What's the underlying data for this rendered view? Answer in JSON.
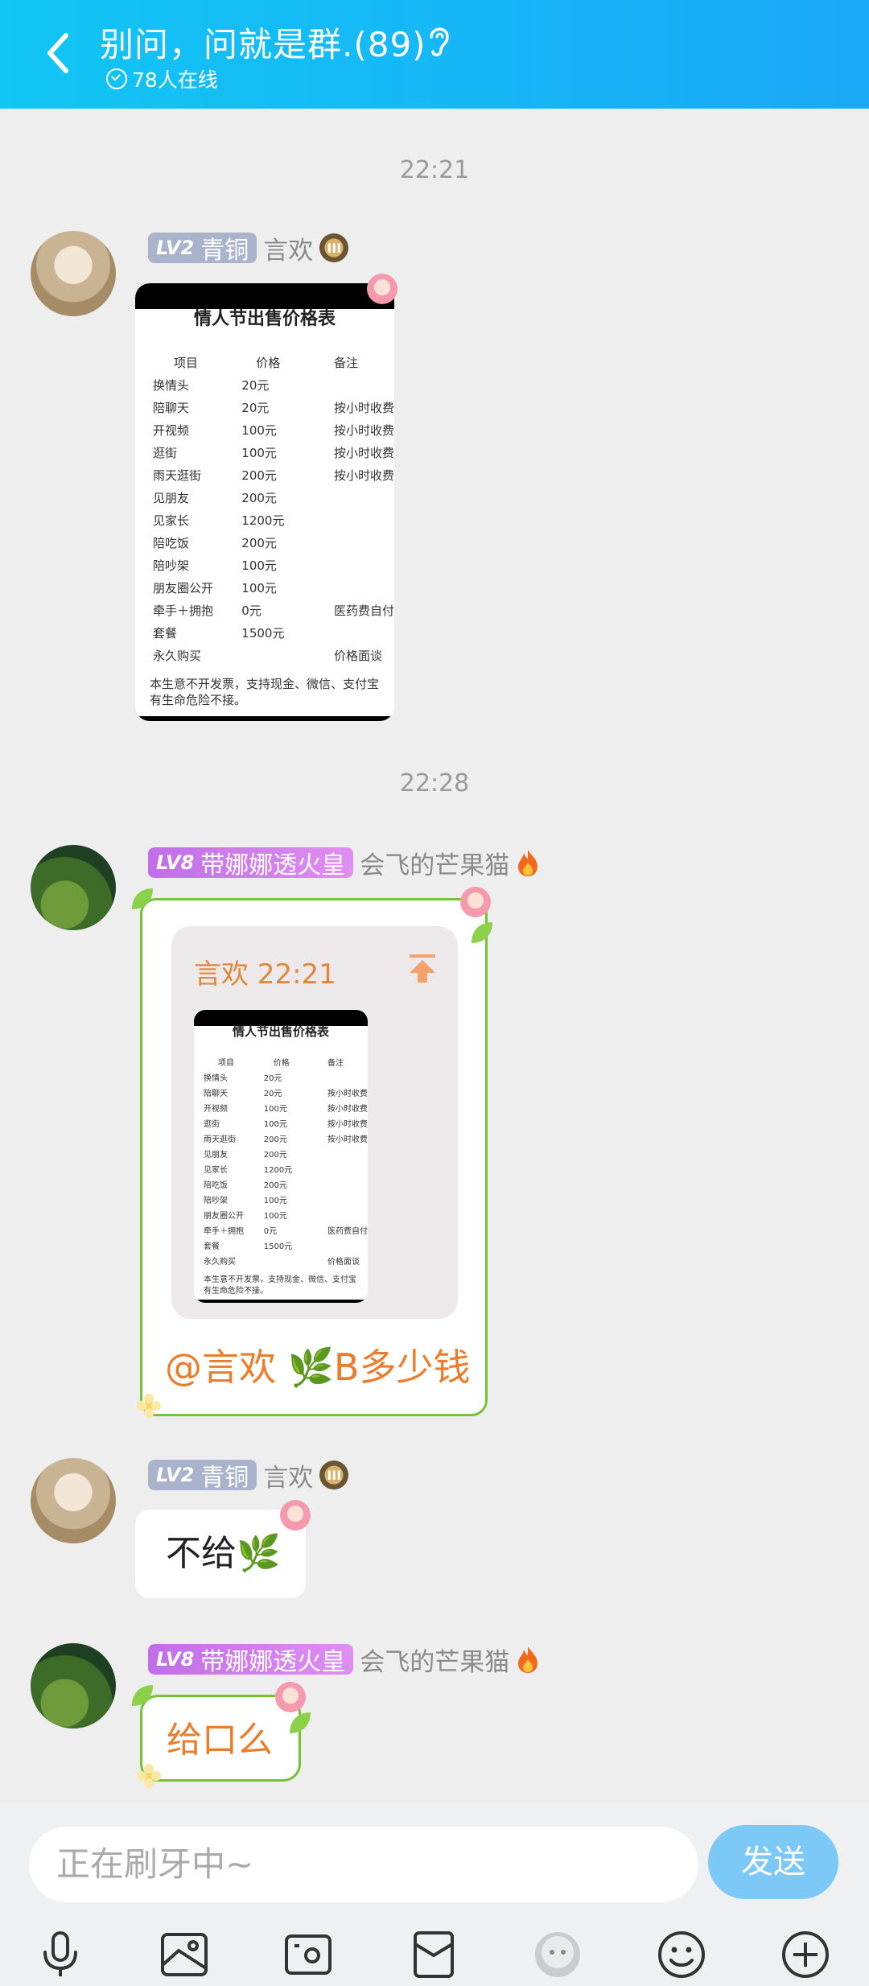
{
  "header": {
    "title": "别问，问就是群.(89)",
    "online": "78人在线"
  },
  "messages": [
    {
      "type": "time",
      "text": "22:21"
    },
    {
      "type": "image",
      "level": "LV2",
      "level_name": "青铜",
      "name": "言欢",
      "badge": "III"
    },
    {
      "type": "time",
      "text": "22:28"
    },
    {
      "type": "quote",
      "level": "LV8",
      "level_name": "带娜娜透火皇",
      "name": "会飞的芒果猫",
      "quoted_name": "言欢",
      "quoted_time": "22:21",
      "text": "@言欢 🌿B多少钱"
    },
    {
      "type": "text",
      "level": "LV2",
      "level_name": "青铜",
      "name": "言欢",
      "badge": "III",
      "text": "不给🌿"
    },
    {
      "type": "text",
      "level": "LV8",
      "level_name": "带娜娜透火皇",
      "name": "会飞的芒果猫",
      "text": "给口么"
    }
  ],
  "price_sheet": {
    "title": "情人节出售价格表",
    "headers": [
      "项目",
      "价格",
      "备注"
    ],
    "rows": [
      [
        "换情头",
        "20元",
        ""
      ],
      [
        "陪聊天",
        "20元",
        "按小时收费"
      ],
      [
        "开视频",
        "100元",
        "按小时收费"
      ],
      [
        "逛街",
        "100元",
        "按小时收费"
      ],
      [
        "雨天逛街",
        "200元",
        "按小时收费"
      ],
      [
        "见朋友",
        "200元",
        ""
      ],
      [
        "见家长",
        "1200元",
        ""
      ],
      [
        "陪吃饭",
        "200元",
        ""
      ],
      [
        "陪吵架",
        "100元",
        ""
      ],
      [
        "朋友圈公开",
        "100元",
        ""
      ],
      [
        "牵手＋拥抱",
        "0元",
        "医药费自付"
      ],
      [
        "套餐",
        "1500元",
        ""
      ],
      [
        "永久购买",
        "",
        "价格面谈"
      ]
    ],
    "footer": "本生意不开发票，支持现金、微信、支付宝有生命危险不接。"
  },
  "input": {
    "placeholder": "正在刷牙中~",
    "send_label": "发送"
  },
  "toolbar": [
    "microphone-icon",
    "image-icon",
    "camera-icon",
    "red-packet-icon",
    "avatar-emote-icon",
    "emoji-icon",
    "plus-icon"
  ],
  "colors": {
    "header": "#16b6f6",
    "send_button": "#7cc8f6",
    "orange_text": "#ea7c2a",
    "green_border": "#74c236"
  }
}
